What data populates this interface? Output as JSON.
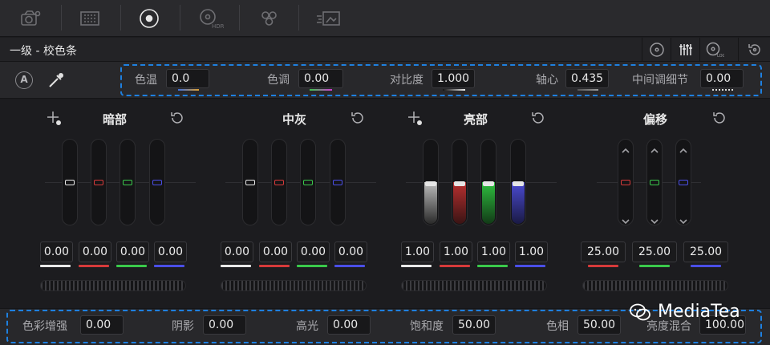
{
  "panel": {
    "title": "一级 - 校色条"
  },
  "toolbar_icons": [
    "camera-raw-icon",
    "color-match-icon",
    "color-wheels-icon",
    "hdr-wheels-icon",
    "rgb-mixer-icon",
    "motion-effects-icon"
  ],
  "mode_icons": [
    "wheels-mode-icon",
    "bars-mode-icon",
    "log-mode-icon",
    "reset-all-icon"
  ],
  "top_params": [
    {
      "label": "色温",
      "value": "0.0"
    },
    {
      "label": "色调",
      "value": "0.00"
    },
    {
      "label": "对比度",
      "value": "1.000"
    },
    {
      "label": "轴心",
      "value": "0.435"
    },
    {
      "label": "中间调细节",
      "value": "0.00"
    }
  ],
  "auto_label": "A",
  "wheels": [
    {
      "name": "暗部",
      "values": [
        "0.00",
        "0.00",
        "0.00",
        "0.00"
      ],
      "level": 0.0
    },
    {
      "name": "中灰",
      "values": [
        "0.00",
        "0.00",
        "0.00",
        "0.00"
      ],
      "level": 0.0
    },
    {
      "name": "亮部",
      "values": [
        "1.00",
        "1.00",
        "1.00",
        "1.00"
      ],
      "level": 1.0
    },
    {
      "name": "偏移",
      "values": [
        "25.00",
        "25.00",
        "25.00"
      ],
      "level": 25.0
    }
  ],
  "bottom_params": [
    {
      "label": "色彩增强",
      "value": "0.00"
    },
    {
      "label": "阴影",
      "value": "0.00"
    },
    {
      "label": "高光",
      "value": "0.00"
    },
    {
      "label": "饱和度",
      "value": "50.00"
    },
    {
      "label": "色相",
      "value": "50.00"
    },
    {
      "label": "亮度混合",
      "value": "100.00"
    }
  ],
  "watermark": "MediaTea",
  "colors": {
    "accent_dash": "#1e80e0",
    "red": "#d63a3a",
    "green": "#3ac94b",
    "blue": "#4a4ee6",
    "white": "#e8e8e8"
  }
}
